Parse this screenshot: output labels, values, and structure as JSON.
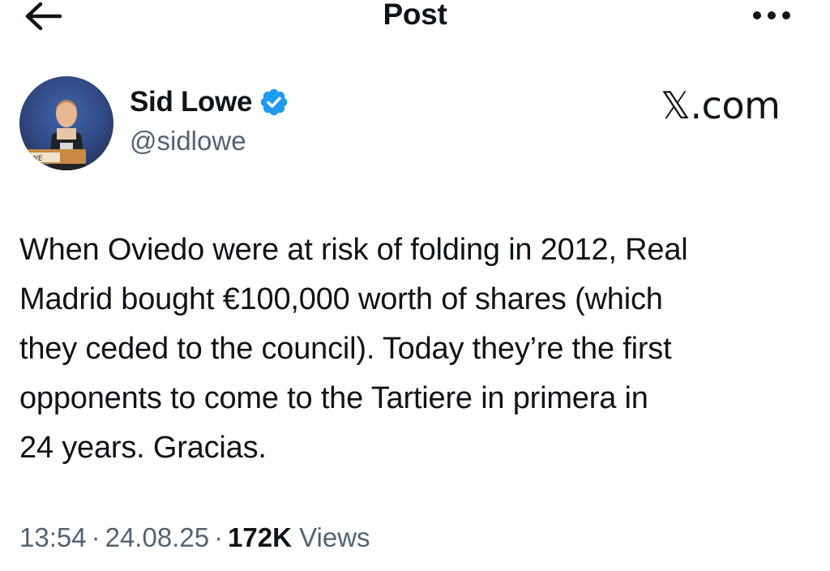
{
  "header": {
    "title": "Post",
    "back_icon": "arrow-left-icon",
    "more_icon": "more-horizontal-icon"
  },
  "author": {
    "name": "Sid Lowe",
    "handle": "@sidlowe",
    "verified_icon": "verified-badge-icon",
    "verified_color": "#1d9bf0"
  },
  "watermark": "𝕏.com",
  "post": {
    "lines": [
      "When Oviedo were at risk of folding in 2012, Real",
      "Madrid bought €100,000 worth of shares (which",
      "they ceded to the council). Today they’re the first",
      "opponents to come to the Tartiere in primera in",
      "24 years. Gracias."
    ]
  },
  "meta": {
    "time": "13:54",
    "date": "24.08.25",
    "views_count": "172K",
    "views_label": "Views",
    "separator": "·"
  },
  "colors": {
    "text": "#0f1419",
    "secondary": "#536471",
    "accent": "#1d9bf0"
  }
}
